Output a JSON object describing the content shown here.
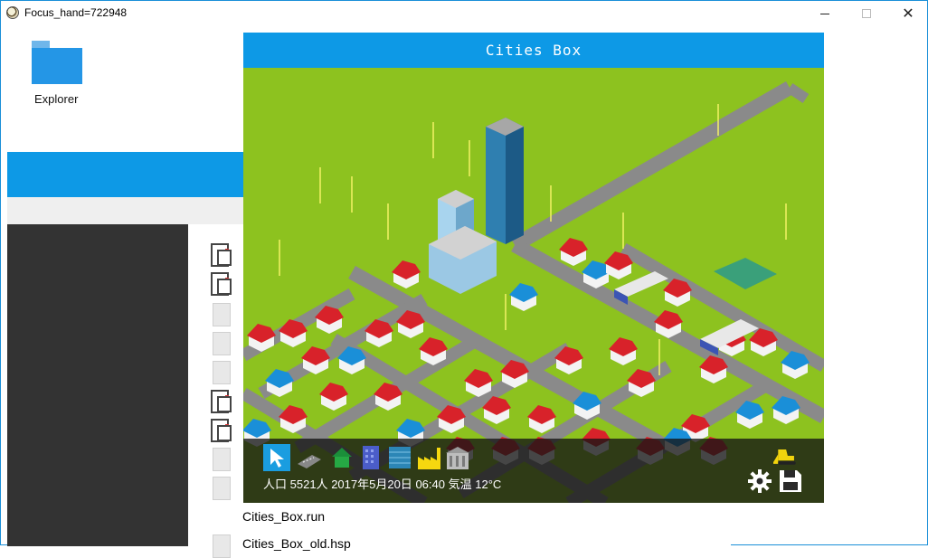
{
  "window": {
    "title": "Focus_hand=722948"
  },
  "desktop": {
    "folder_label": "Explorer"
  },
  "file_list": {
    "items": [
      "Cities_Box.run",
      "Cities_Box_old.hsp"
    ]
  },
  "game": {
    "title": "Cities Box",
    "status": {
      "population_label": "人口",
      "population": "5521人",
      "date": "2017年5月20日",
      "time": "06:40",
      "temp_label": "気温",
      "temperature": "12°C"
    },
    "tools": [
      "pointer-tool-icon",
      "road-tool-icon",
      "house-tool-icon",
      "office-tool-icon",
      "glass-building-tool-icon",
      "factory-tool-icon",
      "public-building-tool-icon"
    ],
    "colors": {
      "title_bar": "#0d99e6",
      "grass": "#8dc21f",
      "road": "#8a8a8a",
      "toolbar": "#141414"
    }
  }
}
